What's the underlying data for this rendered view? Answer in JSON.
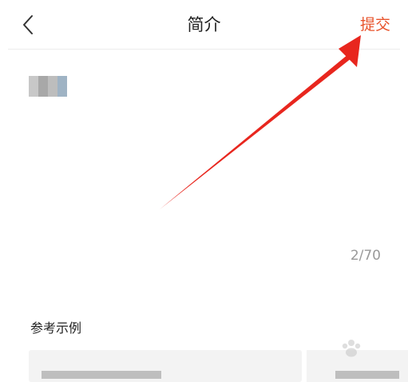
{
  "header": {
    "title": "简介",
    "submit_label": "提交"
  },
  "editor": {
    "char_count": "2/70"
  },
  "examples": {
    "label": "参考示例"
  },
  "colors": {
    "accent": "#e8532b",
    "annotation": "#e8261e",
    "muted": "#999999"
  },
  "icons": {
    "back": "chevron-left-icon",
    "annotation": "arrow-icon",
    "watermark": "paw-icon"
  }
}
